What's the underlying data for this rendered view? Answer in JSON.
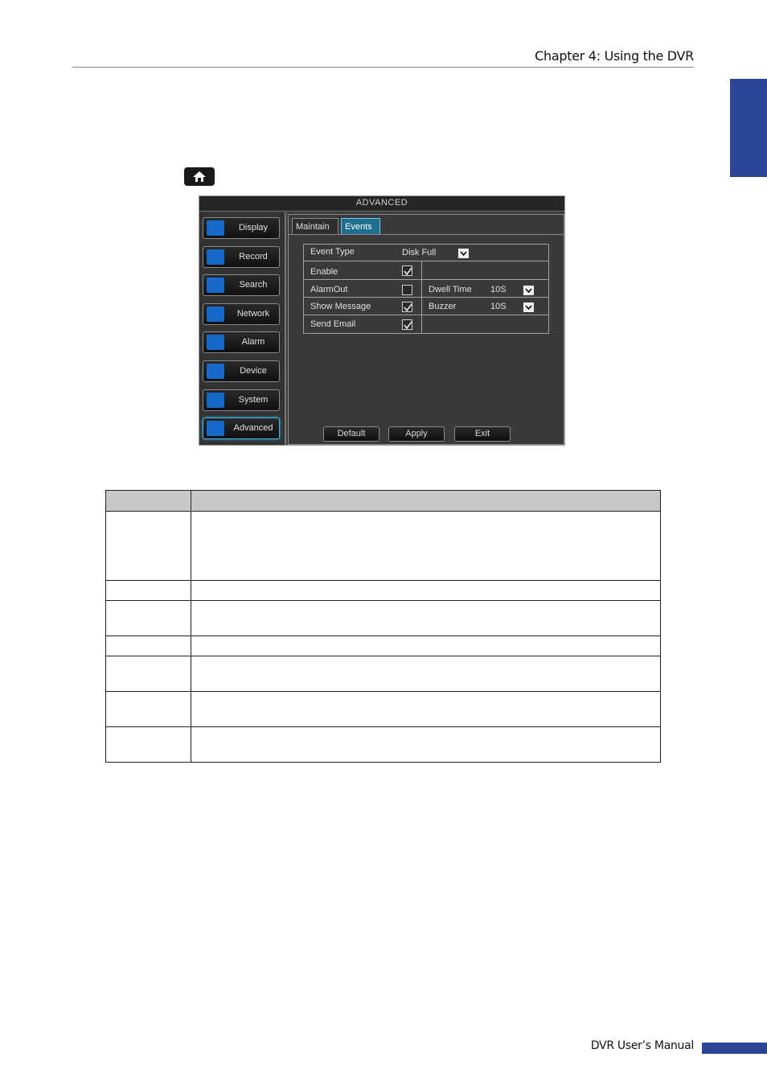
{
  "page": {
    "chapter_title": "Chapter 4: Using the DVR",
    "footer_text": "DVR User’s Manual"
  },
  "dvr": {
    "window_title": "ADVANCED",
    "menu": [
      {
        "label": "Display",
        "icon": "monitor-icon"
      },
      {
        "label": "Record",
        "icon": "film-icon"
      },
      {
        "label": "Search",
        "icon": "magnifier-icon"
      },
      {
        "label": "Network",
        "icon": "globe-icon"
      },
      {
        "label": "Alarm",
        "icon": "alarm-icon"
      },
      {
        "label": "Device",
        "icon": "device-icon"
      },
      {
        "label": "System",
        "icon": "gear-icon"
      },
      {
        "label": "Advanced",
        "icon": "wrench-icon",
        "active": true
      }
    ],
    "tabs": [
      {
        "label": "Maintain"
      },
      {
        "label": "Events",
        "active": true
      }
    ],
    "events": {
      "event_type_label": "Event Type",
      "event_type_value": "Disk Full",
      "enable_label": "Enable",
      "enable_checked": true,
      "alarmout_label": "AlarmOut",
      "alarmout_checked": false,
      "dwell_time_label": "Dwell Time",
      "dwell_time_value": "10S",
      "show_message_label": "Show Message",
      "show_message_checked": true,
      "buzzer_label": "Buzzer",
      "buzzer_value": "10S",
      "send_email_label": "Send Email",
      "send_email_checked": true
    },
    "buttons": {
      "default_label": "Default",
      "apply_label": "Apply",
      "exit_label": "Exit"
    }
  },
  "colors": {
    "accent_blue": "#2b4597",
    "active_tab": "#1f6e8f"
  }
}
